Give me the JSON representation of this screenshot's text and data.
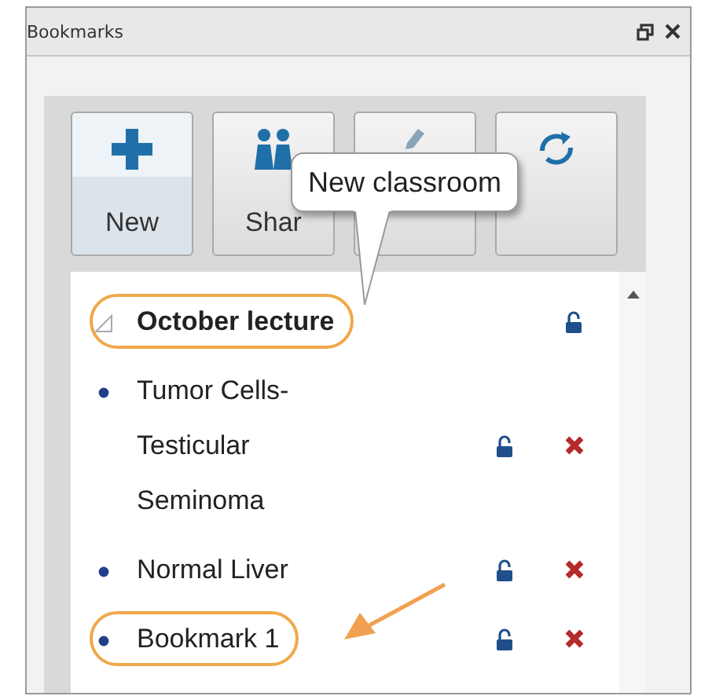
{
  "window": {
    "title": "Bookmarks"
  },
  "toolbar": [
    {
      "kind": "add",
      "label": "New"
    },
    {
      "kind": "share",
      "label": "Shar"
    },
    {
      "kind": "edit"
    },
    {
      "kind": "refresh"
    }
  ],
  "callout": {
    "text": "New classroom"
  },
  "bookmarks": [
    {
      "kind": "folder",
      "label": "October lecture",
      "expanded": true,
      "highlighted": true,
      "locked": false,
      "children": [
        {
          "kind": "bookmark",
          "label": "Tumor Cells-Testicular Seminoma",
          "highlighted": false,
          "locked": false
        },
        {
          "kind": "bookmark",
          "label": "Normal Liver",
          "highlighted": false,
          "locked": false
        },
        {
          "kind": "bookmark",
          "label": "Bookmark 1",
          "highlighted": true,
          "locked": false
        }
      ]
    }
  ]
}
